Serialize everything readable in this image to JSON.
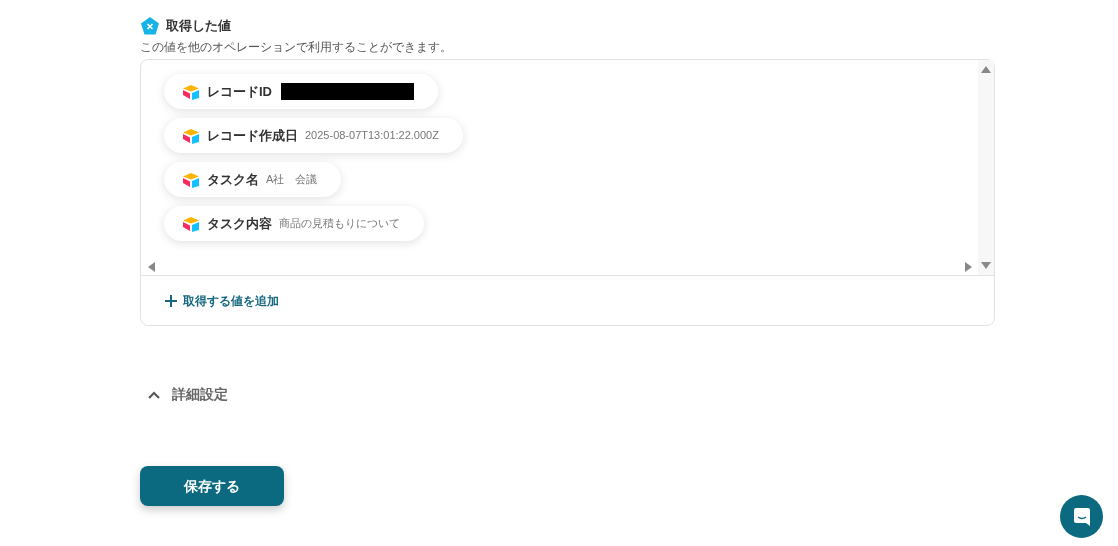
{
  "section": {
    "title": "取得した値",
    "description": "この値を他のオペレーションで利用することができます。"
  },
  "values": [
    {
      "label": "レコードID",
      "kind": "redacted"
    },
    {
      "label": "レコード作成日",
      "kind": "text",
      "value": "2025-08-07T13:01:22.000Z"
    },
    {
      "label": "タスク名",
      "kind": "text",
      "value": "A社　会議"
    },
    {
      "label": "タスク内容",
      "kind": "text",
      "value": "商品の見積もりについて"
    }
  ],
  "add_button": {
    "label": "取得する値を追加"
  },
  "advanced": {
    "label": "詳細設定",
    "expanded": true
  },
  "save_button": {
    "label": "保存する"
  }
}
